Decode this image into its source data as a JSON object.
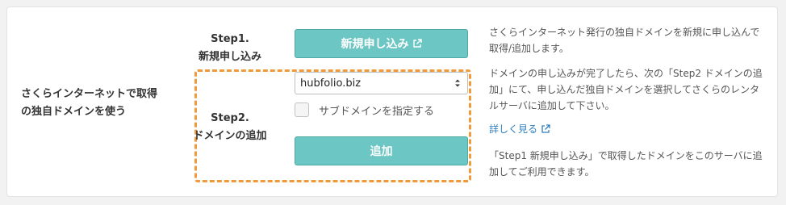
{
  "row_label": [
    "さくらインターネットで取得",
    "の独自ドメインを使う"
  ],
  "step1": {
    "title": [
      "Step1.",
      "新規申し込み"
    ],
    "button_label": "新規申し込み"
  },
  "step2": {
    "title": [
      "Step2.",
      "ドメインの追加"
    ],
    "select_value": "hubfolio.biz",
    "checkbox_label": "サブドメインを指定する",
    "add_button_label": "追加"
  },
  "descriptions": {
    "desc1": "さくらインターネット発行の独自ドメインを新規に申し込んで取得/追加します。",
    "desc2": "ドメインの申し込みが完了したら、次の「Step2 ドメインの追加」にて、申し込んだ独自ドメインを選択してさくらのレンタルサーバに追加して下さい。",
    "more_link": "詳しく見る",
    "desc3": "「Step1 新規申し込み」で取得したドメインをこのサーバに追加してご利用できます。"
  },
  "icons": {
    "external": "external-link-icon",
    "select": "select-arrows-icon"
  },
  "colors": {
    "button_bg": "#6cc6c3",
    "highlight_border": "#f09a3e",
    "link": "#2f7fbf"
  }
}
